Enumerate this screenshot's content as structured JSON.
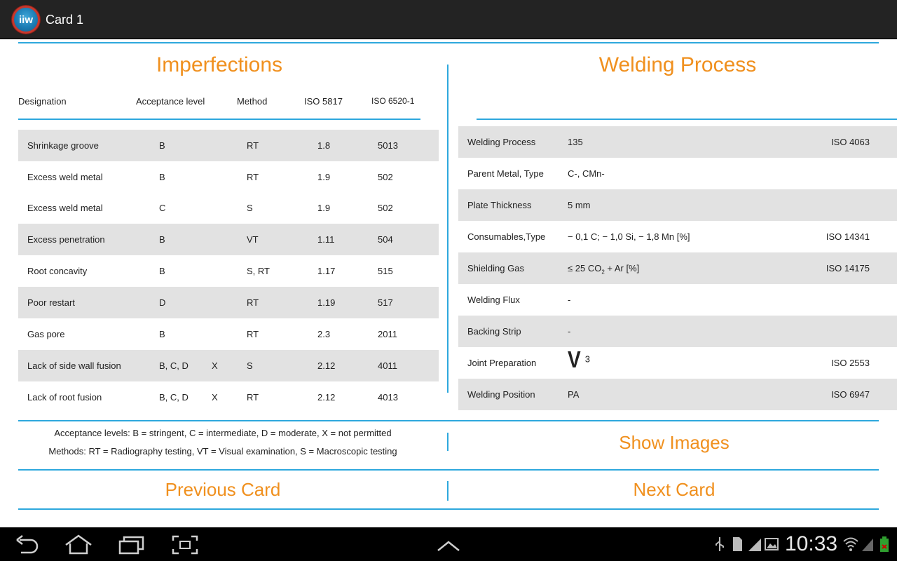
{
  "app": {
    "title": "Card 1",
    "icon_text": "iiw"
  },
  "imperfections": {
    "title": "Imperfections",
    "columns": [
      "Designation",
      "Acceptance level",
      "Method",
      "ISO 5817",
      "ISO 6520-1"
    ],
    "rows": [
      {
        "designation": "Shrinkage groove",
        "acceptance": "B",
        "x": "",
        "method": "RT",
        "iso5817": "1.8",
        "iso6520": "5013"
      },
      {
        "designation": "Excess weld metal",
        "acceptance": "B",
        "x": "",
        "method": "RT",
        "iso5817": "1.9",
        "iso6520": "502"
      },
      {
        "designation": "Excess weld metal",
        "acceptance": "C",
        "x": "",
        "method": "S",
        "iso5817": "1.9",
        "iso6520": "502"
      },
      {
        "designation": "Excess penetration",
        "acceptance": "B",
        "x": "",
        "method": "VT",
        "iso5817": "1.11",
        "iso6520": "504"
      },
      {
        "designation": "Root concavity",
        "acceptance": "B",
        "x": "",
        "method": "S, RT",
        "iso5817": "1.17",
        "iso6520": "515"
      },
      {
        "designation": "Poor restart",
        "acceptance": "D",
        "x": "",
        "method": "RT",
        "iso5817": "1.19",
        "iso6520": "517"
      },
      {
        "designation": "Gas pore",
        "acceptance": "B",
        "x": "",
        "method": "RT",
        "iso5817": "2.3",
        "iso6520": "2011"
      },
      {
        "designation": "Lack of side wall fusion",
        "acceptance": "B, C, D",
        "x": "X",
        "method": "S",
        "iso5817": "2.12",
        "iso6520": "4011"
      },
      {
        "designation": "Lack of root fusion",
        "acceptance": "B, C, D",
        "x": "X",
        "method": "RT",
        "iso5817": "2.12",
        "iso6520": "4013"
      }
    ]
  },
  "welding": {
    "title": "Welding Process",
    "rows": [
      {
        "label": "Welding Process",
        "value": "135",
        "iso": "ISO 4063"
      },
      {
        "label": "Parent Metal, Type",
        "value": "C-, CMn-",
        "iso": ""
      },
      {
        "label": "Plate Thickness",
        "value": "5 mm",
        "iso": ""
      },
      {
        "label": "Consumables,Type",
        "value": " − 0,1 C;  − 1,0 Si,  − 1,8 Mn [%]",
        "iso": "ISO 14341"
      },
      {
        "label": "Shielding Gas",
        "value_pre": "≤ 25 CO",
        "value_sub": "2",
        "value_post": " + Ar [%]",
        "iso": "ISO 14175"
      },
      {
        "label": "Welding Flux",
        "value": "-",
        "iso": ""
      },
      {
        "label": "Backing Strip",
        "value": "-",
        "iso": ""
      },
      {
        "label": "Joint Preparation",
        "symbol": "V",
        "value": "3",
        "iso": "ISO 2553"
      },
      {
        "label": "Welding Position",
        "value": "PA",
        "iso": "ISO 6947"
      }
    ]
  },
  "legend": {
    "line1": "Acceptance levels: B = stringent, C = intermediate, D = moderate, X = not permitted",
    "line2": "Methods: RT = Radiography testing, VT = Visual examination, S = Macroscopic testing"
  },
  "actions": {
    "show_images": "Show Images",
    "previous_card": "Previous Card",
    "next_card": "Next Card"
  },
  "status_bar": {
    "time": "10:33"
  },
  "colors": {
    "accent_orange": "#f0901e",
    "line_blue": "#2ea8dd",
    "row_shade": "#e2e2e2",
    "bar_dark": "#232323"
  }
}
